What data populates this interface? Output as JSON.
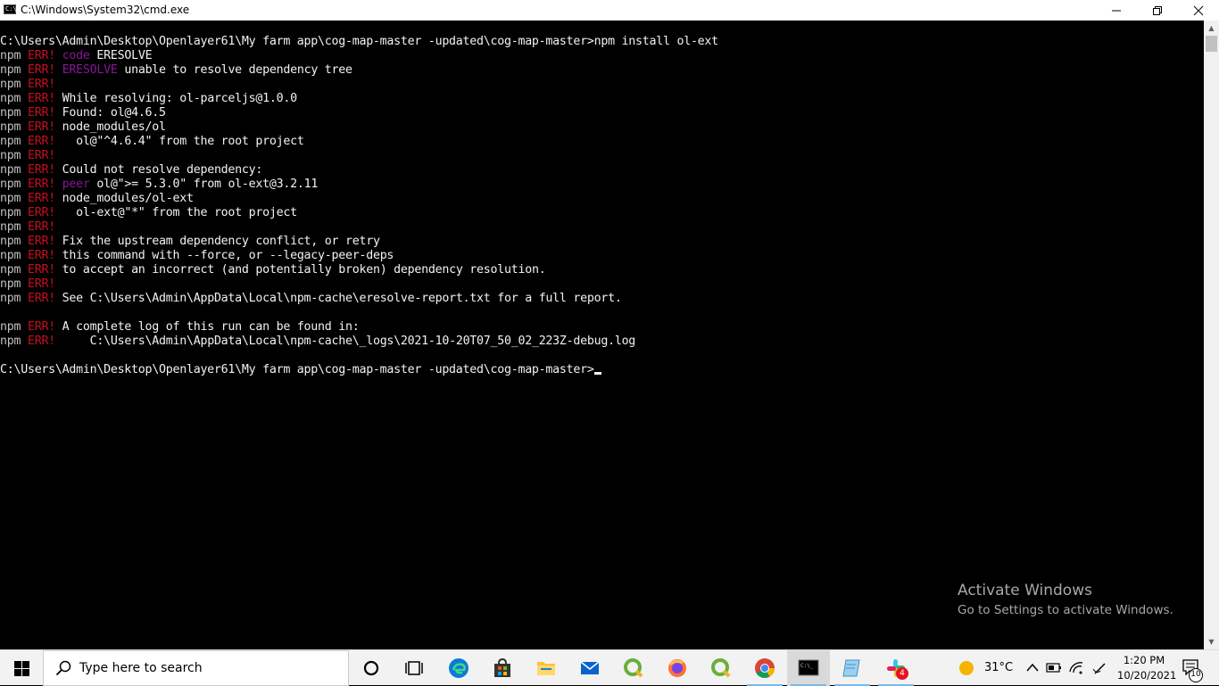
{
  "window": {
    "title": "C:\\Windows\\System32\\cmd.exe",
    "minimize_icon": "minimize-icon",
    "maximize_icon": "restore-icon",
    "close_icon": "close-icon"
  },
  "console": {
    "lines": [
      {
        "segments": [
          {
            "t": "C:\\Users\\Admin\\Desktop\\Openlayer61\\My farm app\\cog-map-master -updated\\cog-map-master>npm install ol-ext",
            "c": "hi"
          }
        ]
      },
      {
        "segments": [
          {
            "t": "npm ",
            "c": ""
          },
          {
            "t": "ERR!",
            "c": "err"
          },
          {
            "t": " ",
            "c": ""
          },
          {
            "t": "code",
            "c": "kw"
          },
          {
            "t": " ERESOLVE",
            "c": "hi"
          }
        ]
      },
      {
        "segments": [
          {
            "t": "npm ",
            "c": ""
          },
          {
            "t": "ERR!",
            "c": "err"
          },
          {
            "t": " ",
            "c": ""
          },
          {
            "t": "ERESOLVE",
            "c": "kw"
          },
          {
            "t": " unable to resolve dependency tree",
            "c": "hi"
          }
        ]
      },
      {
        "segments": [
          {
            "t": "npm ",
            "c": ""
          },
          {
            "t": "ERR!",
            "c": "err"
          }
        ]
      },
      {
        "segments": [
          {
            "t": "npm ",
            "c": ""
          },
          {
            "t": "ERR!",
            "c": "err"
          },
          {
            "t": " While resolving: ",
            "c": "hi"
          },
          {
            "t": "ol-parceljs@1.0.0",
            "c": "hi"
          }
        ]
      },
      {
        "segments": [
          {
            "t": "npm ",
            "c": ""
          },
          {
            "t": "ERR!",
            "c": "err"
          },
          {
            "t": " Found: ",
            "c": "hi"
          },
          {
            "t": "ol@4.6.5",
            "c": "hi"
          }
        ]
      },
      {
        "segments": [
          {
            "t": "npm ",
            "c": ""
          },
          {
            "t": "ERR!",
            "c": "err"
          },
          {
            "t": " node_modules/ol",
            "c": "hi"
          }
        ]
      },
      {
        "segments": [
          {
            "t": "npm ",
            "c": ""
          },
          {
            "t": "ERR!",
            "c": "err"
          },
          {
            "t": "   ol@\"^4.6.4\" from the root project",
            "c": "hi"
          }
        ]
      },
      {
        "segments": [
          {
            "t": "npm ",
            "c": ""
          },
          {
            "t": "ERR!",
            "c": "err"
          }
        ]
      },
      {
        "segments": [
          {
            "t": "npm ",
            "c": ""
          },
          {
            "t": "ERR!",
            "c": "err"
          },
          {
            "t": " Could not resolve dependency:",
            "c": "hi"
          }
        ]
      },
      {
        "segments": [
          {
            "t": "npm ",
            "c": ""
          },
          {
            "t": "ERR!",
            "c": "err"
          },
          {
            "t": " ",
            "c": ""
          },
          {
            "t": "peer",
            "c": "kw"
          },
          {
            "t": " ol@\">= 5.3.0\" from ol-ext@3.2.11",
            "c": "hi"
          }
        ]
      },
      {
        "segments": [
          {
            "t": "npm ",
            "c": ""
          },
          {
            "t": "ERR!",
            "c": "err"
          },
          {
            "t": " node_modules/ol-ext",
            "c": "hi"
          }
        ]
      },
      {
        "segments": [
          {
            "t": "npm ",
            "c": ""
          },
          {
            "t": "ERR!",
            "c": "err"
          },
          {
            "t": "   ol-ext@\"*\" from the root project",
            "c": "hi"
          }
        ]
      },
      {
        "segments": [
          {
            "t": "npm ",
            "c": ""
          },
          {
            "t": "ERR!",
            "c": "err"
          }
        ]
      },
      {
        "segments": [
          {
            "t": "npm ",
            "c": ""
          },
          {
            "t": "ERR!",
            "c": "err"
          },
          {
            "t": " Fix the upstream dependency conflict, or retry",
            "c": "hi"
          }
        ]
      },
      {
        "segments": [
          {
            "t": "npm ",
            "c": ""
          },
          {
            "t": "ERR!",
            "c": "err"
          },
          {
            "t": " this command with --force, or --legacy-peer-deps",
            "c": "hi"
          }
        ]
      },
      {
        "segments": [
          {
            "t": "npm ",
            "c": ""
          },
          {
            "t": "ERR!",
            "c": "err"
          },
          {
            "t": " to accept an incorrect (and potentially broken) dependency resolution.",
            "c": "hi"
          }
        ]
      },
      {
        "segments": [
          {
            "t": "npm ",
            "c": ""
          },
          {
            "t": "ERR!",
            "c": "err"
          }
        ]
      },
      {
        "segments": [
          {
            "t": "npm ",
            "c": ""
          },
          {
            "t": "ERR!",
            "c": "err"
          },
          {
            "t": " See C:\\Users\\Admin\\AppData\\Local\\npm-cache\\eresolve-report.txt for a full report.",
            "c": "hi"
          }
        ]
      },
      {
        "segments": []
      },
      {
        "segments": [
          {
            "t": "npm ",
            "c": ""
          },
          {
            "t": "ERR!",
            "c": "err"
          },
          {
            "t": " A complete log of this run can be found in:",
            "c": "hi"
          }
        ]
      },
      {
        "segments": [
          {
            "t": "npm ",
            "c": ""
          },
          {
            "t": "ERR!",
            "c": "err"
          },
          {
            "t": "     C:\\Users\\Admin\\AppData\\Local\\npm-cache\\_logs\\2021-10-20T07_50_02_223Z-debug.log",
            "c": "hi"
          }
        ]
      },
      {
        "segments": []
      },
      {
        "segments": [
          {
            "t": "C:\\Users\\Admin\\Desktop\\Openlayer61\\My farm app\\cog-map-master -updated\\cog-map-master>",
            "c": "hi"
          }
        ],
        "cursor": true
      }
    ]
  },
  "watermark": {
    "line1": "Activate Windows",
    "line2": "Go to Settings to activate Windows."
  },
  "taskbar": {
    "search_placeholder": "Type here to search",
    "apps": [
      {
        "name": "cortana-icon"
      },
      {
        "name": "task-view-icon"
      },
      {
        "name": "edge-icon"
      },
      {
        "name": "store-icon"
      },
      {
        "name": "file-explorer-icon"
      },
      {
        "name": "mail-icon"
      },
      {
        "name": "qgis-icon"
      },
      {
        "name": "firefox-icon"
      },
      {
        "name": "qgis-icon"
      },
      {
        "name": "chrome-icon"
      },
      {
        "name": "cmd-icon"
      },
      {
        "name": "notepad-icon"
      },
      {
        "name": "slack-icon",
        "badge": "4"
      }
    ],
    "weather_temp": "31°C",
    "time": "1:20 PM",
    "date": "10/20/2021",
    "notification_count": "10"
  }
}
